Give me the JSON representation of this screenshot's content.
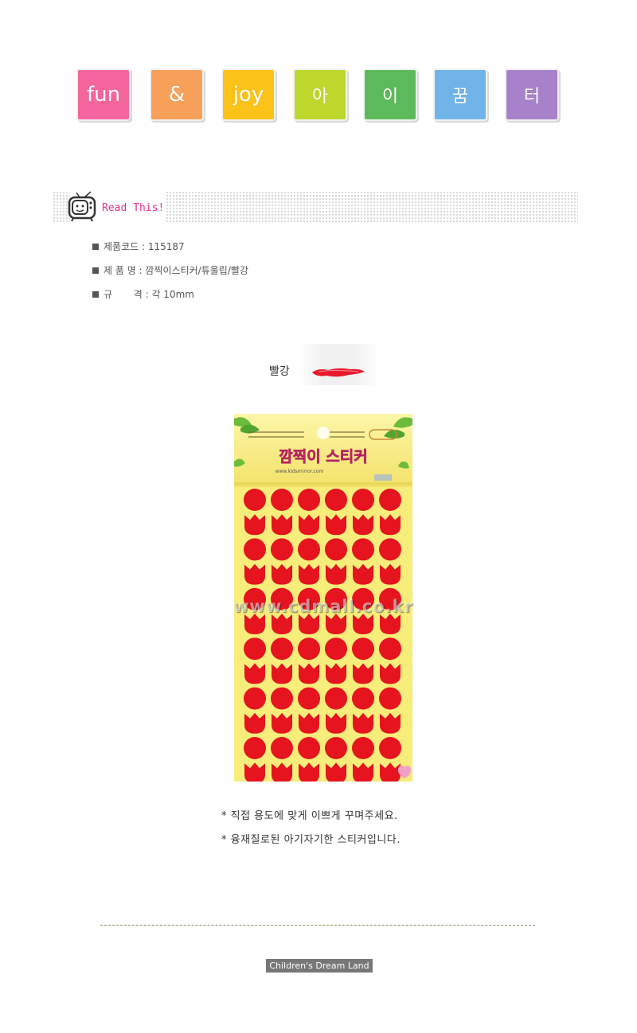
{
  "header_tiles": [
    {
      "text": "fun",
      "color": "#f4649d"
    },
    {
      "text": "&",
      "color": "#f6a05a"
    },
    {
      "text": "joy",
      "color": "#fbc21a"
    },
    {
      "text": "아",
      "color": "#bdd72c"
    },
    {
      "text": "이",
      "color": "#5dba5b"
    },
    {
      "text": "꿈",
      "color": "#6fb3e8"
    },
    {
      "text": "터",
      "color": "#a781c9"
    }
  ],
  "read_this": {
    "label": "Read This!",
    "color": "#e8318f"
  },
  "specs": [
    {
      "text": "제품코드 : 115187"
    },
    {
      "text": "제 품 명 : 깜찍이스티커/튜울립/빨강"
    },
    {
      "text": "규       격 : 각 10mm"
    }
  ],
  "color_option": {
    "label": "빨강",
    "swatch_color": "#e8192c"
  },
  "product": {
    "title": "깜찍이 스티커",
    "url_text": "www.kidsmirror.com",
    "sticker_color": "#e5141f",
    "card_color": "#f6ed7a",
    "watermark": "www.cdmall.co.kr"
  },
  "notes": [
    "* 직접 용도에 맞게 이쁘게 꾸며주세요.",
    "* 융재질로된 아기자기한 스티커입니다."
  ],
  "footer": {
    "badge": "Children's Dream Land"
  }
}
